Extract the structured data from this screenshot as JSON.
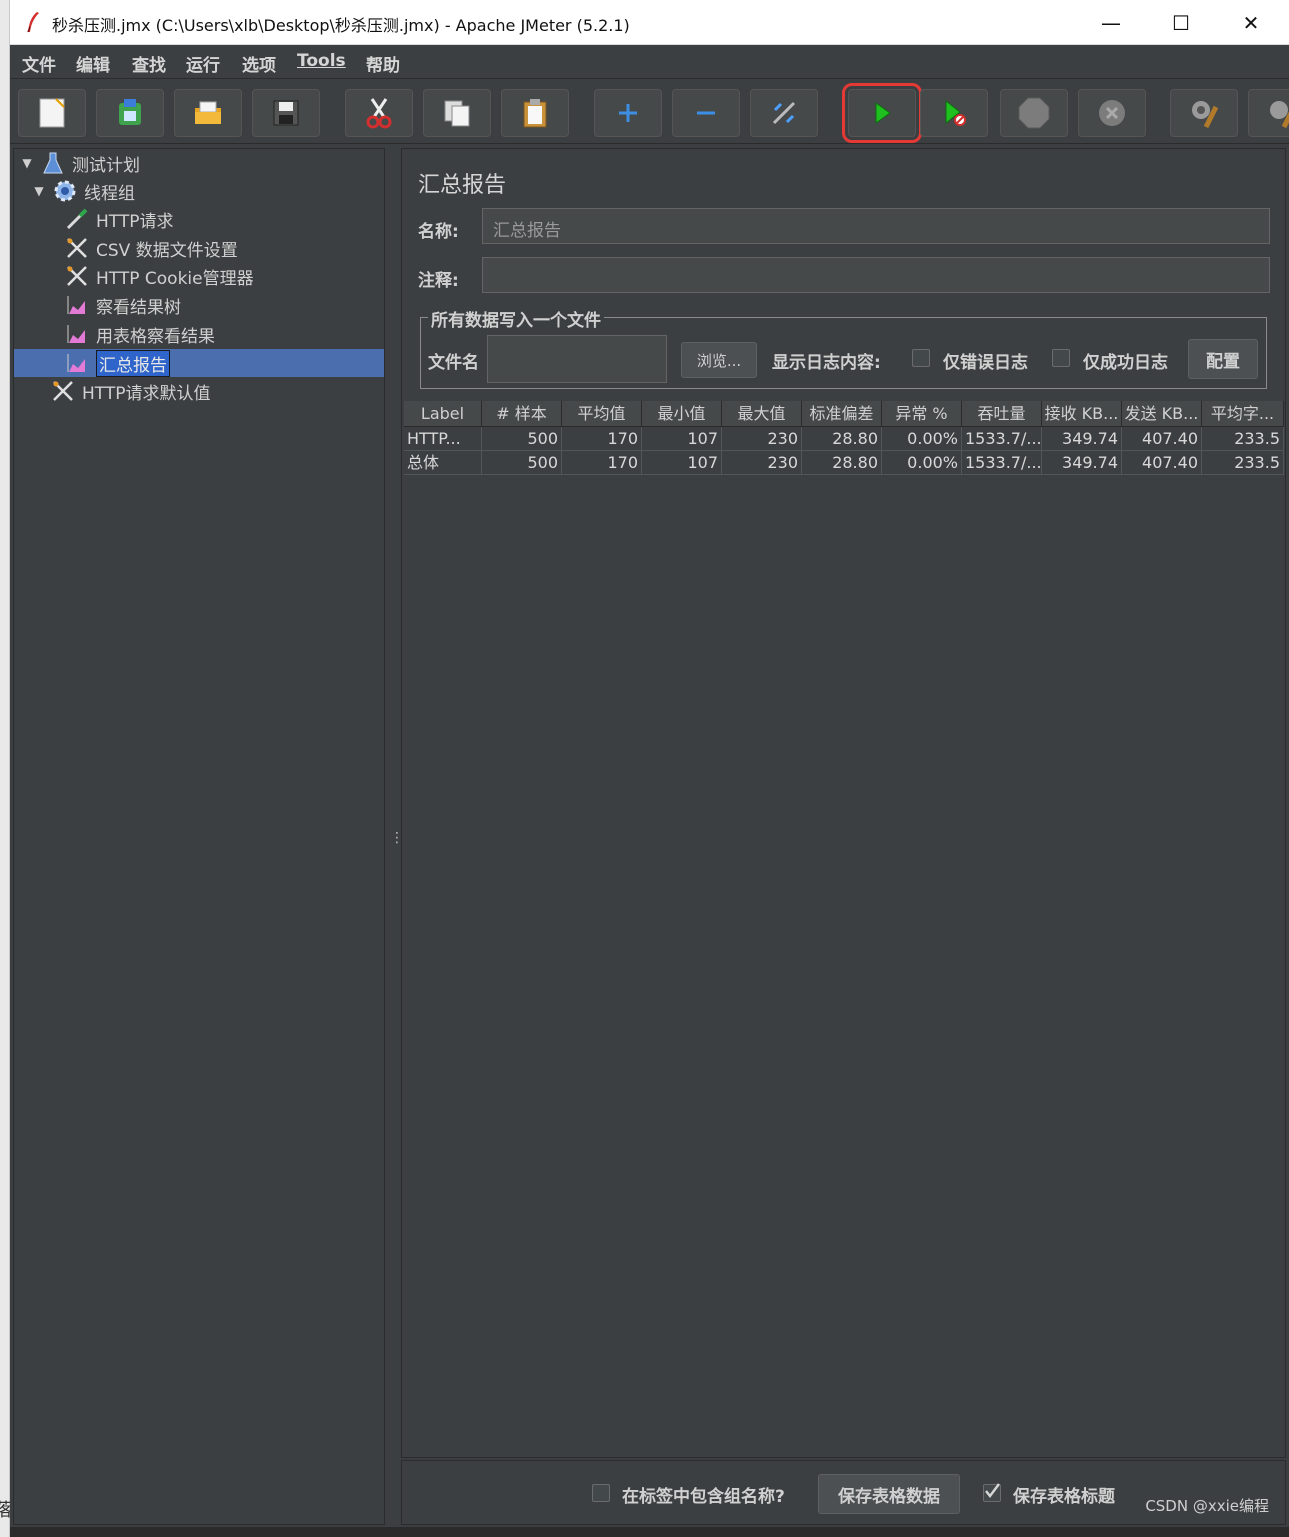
{
  "window": {
    "title": "秒杀压测.jmx (C:\\Users\\xlb\\Desktop\\秒杀压测.jmx) - Apache JMeter (5.2.1)",
    "minimize": "—",
    "maximize": "☐",
    "close": "✕"
  },
  "menu": [
    "文件",
    "编辑",
    "查找",
    "运行",
    "选项",
    "Tools",
    "帮助"
  ],
  "tree": {
    "items": [
      {
        "label": "测试计划",
        "icon": "flask-icon",
        "expanded": true
      },
      {
        "label": "线程组",
        "icon": "gear-icon",
        "expanded": true
      },
      {
        "label": "HTTP请求",
        "icon": "pipette-icon"
      },
      {
        "label": "CSV 数据文件设置",
        "icon": "scissors-icon"
      },
      {
        "label": "HTTP Cookie管理器",
        "icon": "scissors-icon"
      },
      {
        "label": "察看结果树",
        "icon": "chart-icon"
      },
      {
        "label": "用表格察看结果",
        "icon": "chart-icon"
      },
      {
        "label": "汇总报告",
        "icon": "chart-icon",
        "selected": true
      },
      {
        "label": "HTTP请求默认值",
        "icon": "scissors-icon"
      }
    ]
  },
  "panel": {
    "title": "汇总报告",
    "name_label": "名称:",
    "name_value": "汇总报告",
    "comment_label": "注释:",
    "comment_value": "",
    "file_group_title": "所有数据写入一个文件",
    "filename_label": "文件名",
    "filename_value": "",
    "browse_button": "浏览...",
    "log_content_label": "显示日志内容:",
    "errors_only_label": "仅错误日志",
    "success_only_label": "仅成功日志",
    "configure_button": "配置"
  },
  "table": {
    "headers": [
      "Label",
      "# 样本",
      "平均值",
      "最小值",
      "最大值",
      "标准偏差",
      "异常 %",
      "吞吐量",
      "接收 KB...",
      "发送 KB...",
      "平均字..."
    ],
    "rows": [
      [
        "HTTP...",
        "500",
        "170",
        "107",
        "230",
        "28.80",
        "0.00%",
        "1533.7/...",
        "349.74",
        "407.40",
        "233.5"
      ],
      [
        "总体",
        "500",
        "170",
        "107",
        "230",
        "28.80",
        "0.00%",
        "1533.7/...",
        "349.74",
        "407.40",
        "233.5"
      ]
    ]
  },
  "bottom": {
    "include_group_label": "在标签中包含组名称?",
    "include_group_checked": false,
    "save_table_button": "保存表格数据",
    "save_header_label": "保存表格标题",
    "save_header_checked": true,
    "watermark": "CSDN @xxie编程"
  },
  "colors": {
    "background": "#3c3f41",
    "selection": "#4b6eaf",
    "highlight": "#e53935",
    "start_green": "#1fbf1f"
  }
}
